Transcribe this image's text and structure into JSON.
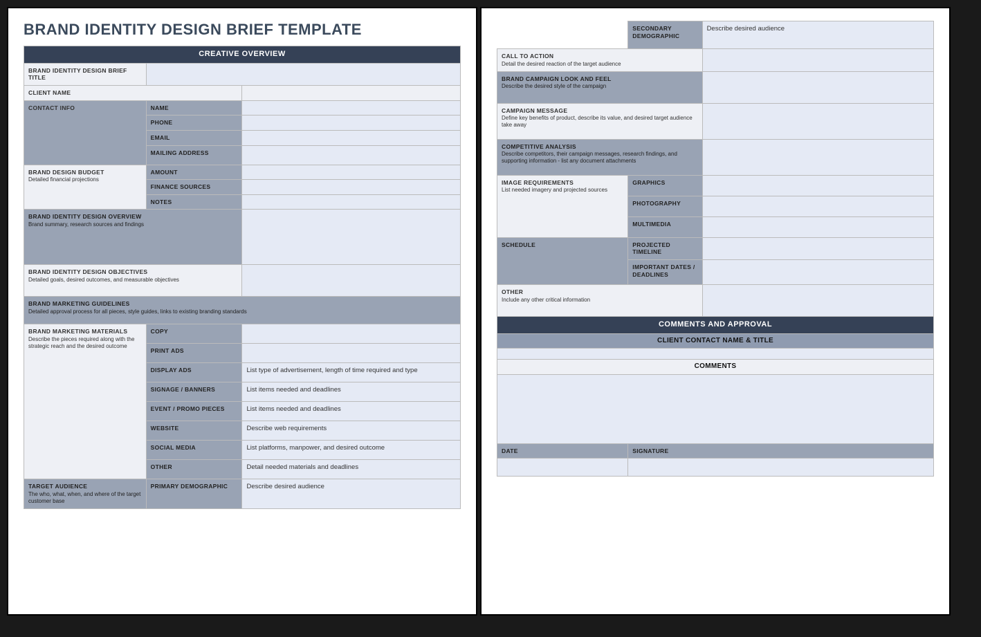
{
  "title": "BRAND IDENTITY DESIGN BRIEF TEMPLATE",
  "section_creative": "CREATIVE OVERVIEW",
  "brief_title_label": "BRAND IDENTITY DESIGN BRIEF TITLE",
  "client_name_label": "CLIENT NAME",
  "contact_info_label": "CONTACT INFO",
  "contact": {
    "name": "NAME",
    "phone": "PHONE",
    "email": "EMAIL",
    "mailing": "MAILING ADDRESS"
  },
  "budget_label": "BRAND DESIGN BUDGET",
  "budget_sub": "Detailed financial projections",
  "budget": {
    "amount": "AMOUNT",
    "finance": "FINANCE SOURCES",
    "notes": "NOTES"
  },
  "overview_label": "BRAND IDENTITY DESIGN OVERVIEW",
  "overview_sub": "Brand summary, research sources and findings",
  "objectives_label": "BRAND IDENTITY DESIGN OBJECTIVES",
  "objectives_sub": "Detailed goals, desired outcomes, and measurable objectives",
  "guidelines_label": "BRAND MARKETING GUIDELINES",
  "guidelines_sub": "Detailed approval process for all pieces, style guides, links to existing branding standards",
  "materials_label": "BRAND MARKETING MATERIALS",
  "materials_sub": "Describe the pieces required along with the strategic reach and the desired outcome",
  "materials": {
    "copy": "COPY",
    "print": "PRINT ADS",
    "display": "DISPLAY ADS",
    "display_val": "List type of advertisement, length of time required and type",
    "signage": "SIGNAGE / BANNERS",
    "signage_val": "List items needed and deadlines",
    "event": "EVENT / PROMO PIECES",
    "event_val": "List items needed and deadlines",
    "website": "WEBSITE",
    "website_val": "Describe web requirements",
    "social": "SOCIAL MEDIA",
    "social_val": "List platforms, manpower, and desired outcome",
    "other": "OTHER",
    "other_val": "Detail needed materials and deadlines"
  },
  "audience_label": "TARGET AUDIENCE",
  "audience_sub": "The who, what, when, and where of the target customer base",
  "audience": {
    "primary": "PRIMARY DEMOGRAPHIC",
    "primary_val": "Describe desired audience",
    "secondary": "SECONDARY DEMOGRAPHIC",
    "secondary_val": "Describe desired audience"
  },
  "cta_label": "CALL TO ACTION",
  "cta_sub": "Detail the desired reaction of the target audience",
  "look_label": "BRAND CAMPAIGN LOOK AND FEEL",
  "look_sub": "Describe the desired style of the campaign",
  "message_label": "CAMPAIGN MESSAGE",
  "message_sub": "Define key benefits of product, describe its value, and desired target audience take away",
  "competitive_label": "COMPETITIVE ANALYSIS",
  "competitive_sub": "Describe competitors, their campaign messages, research findings, and supporting information - list any document attachments",
  "image_label": "IMAGE REQUIREMENTS",
  "image_sub": "List needed imagery and projected sources",
  "image": {
    "graphics": "GRAPHICS",
    "photo": "PHOTOGRAPHY",
    "multimedia": "MULTIMEDIA"
  },
  "schedule_label": "SCHEDULE",
  "schedule": {
    "timeline": "PROJECTED TIMELINE",
    "dates": "IMPORTANT DATES / DEADLINES"
  },
  "other_label": "OTHER",
  "other_sub": "Include any other critical information",
  "section_comments": "COMMENTS AND APPROVAL",
  "client_contact_header": "CLIENT CONTACT NAME & TITLE",
  "comments_header": "COMMENTS",
  "date_label": "DATE",
  "signature_label": "SIGNATURE"
}
